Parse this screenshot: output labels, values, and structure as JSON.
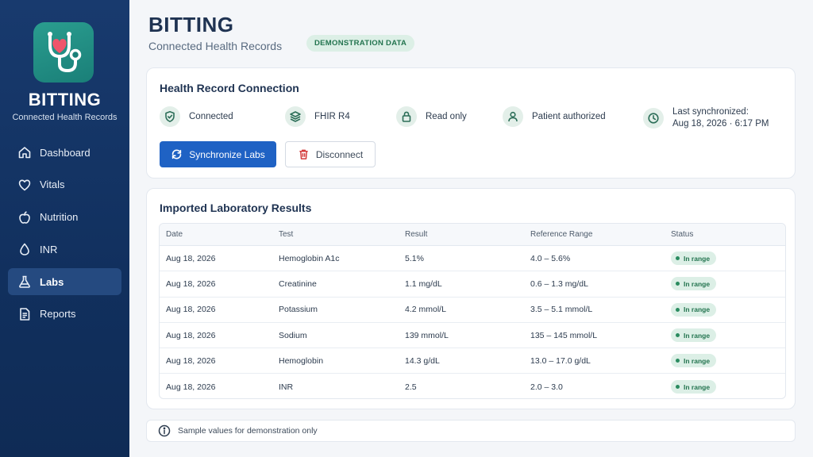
{
  "brand": {
    "name": "BITTING",
    "tagline": "Connected Health Records",
    "logo_icon": "stethoscope-heart-icon",
    "logo_color": "#2a9d8f"
  },
  "sidebar": {
    "items": [
      {
        "label": "Dashboard",
        "icon": "home-icon",
        "active": false
      },
      {
        "label": "Vitals",
        "icon": "heart-icon",
        "active": false
      },
      {
        "label": "Nutrition",
        "icon": "apple-icon",
        "active": false
      },
      {
        "label": "INR",
        "icon": "drop-icon",
        "active": false
      },
      {
        "label": "Labs",
        "icon": "flask-icon",
        "active": true
      },
      {
        "label": "Reports",
        "icon": "document-icon",
        "active": false
      }
    ]
  },
  "header": {
    "title": "BITTING",
    "subtitle": "Connected Health Records",
    "badge": "DEMONSTRATION DATA"
  },
  "connection": {
    "title": "Health Record Connection",
    "status": [
      {
        "label": "Connected",
        "icon": "shield-check-icon"
      },
      {
        "label": "FHIR R4",
        "icon": "layers-icon"
      },
      {
        "label": "Read only",
        "icon": "lock-icon"
      },
      {
        "label": "Patient authorized",
        "icon": "user-icon"
      }
    ],
    "last_sync_label": "Last synchronized:",
    "last_sync_value": "Aug 18, 2026 · 6:17 PM",
    "sync_button": "Synchronize Labs",
    "disconnect_button": "Disconnect"
  },
  "labs": {
    "title": "Imported Laboratory Results",
    "columns": [
      "Date",
      "Test",
      "Result",
      "Reference Range",
      "Status"
    ],
    "rows": [
      {
        "date": "Aug 18, 2026",
        "test": "Hemoglobin A1c",
        "result": "5.1%",
        "range": "4.0 – 5.6%",
        "status": "In range"
      },
      {
        "date": "Aug 18, 2026",
        "test": "Creatinine",
        "result": "1.1 mg/dL",
        "range": "0.6 – 1.3 mg/dL",
        "status": "In range"
      },
      {
        "date": "Aug 18, 2026",
        "test": "Potassium",
        "result": "4.2 mmol/L",
        "range": "3.5 – 5.1 mmol/L",
        "status": "In range"
      },
      {
        "date": "Aug 18, 2026",
        "test": "Sodium",
        "result": "139 mmol/L",
        "range": "135 – 145 mmol/L",
        "status": "In range"
      },
      {
        "date": "Aug 18, 2026",
        "test": "Hemoglobin",
        "result": "14.3 g/dL",
        "range": "13.0 – 17.0 g/dL",
        "status": "In range"
      },
      {
        "date": "Aug 18, 2026",
        "test": "INR",
        "result": "2.5",
        "range": "2.0 – 3.0",
        "status": "In range"
      }
    ]
  },
  "footer": {
    "note": "Sample values for demonstration only",
    "icon": "info-icon"
  },
  "colors": {
    "sidebar": "#11305e",
    "primary": "#1f62c4",
    "success": "#23744f",
    "danger": "#d33a3a"
  }
}
